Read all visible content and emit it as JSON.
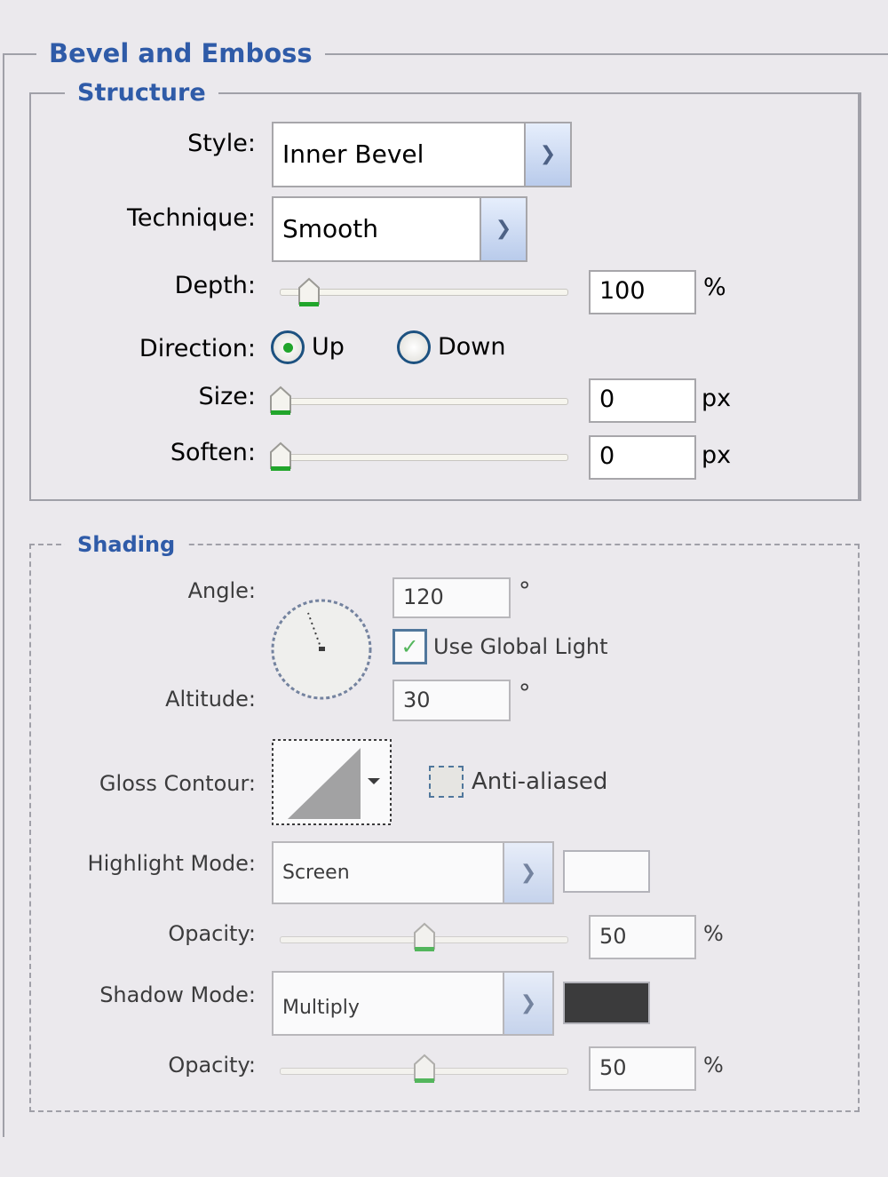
{
  "title": "Bevel and Emboss",
  "structure": {
    "title": "Structure",
    "style": {
      "label": "Style:",
      "value": "Inner Bevel"
    },
    "technique": {
      "label": "Technique:",
      "value": "Smooth"
    },
    "depth": {
      "label": "Depth:",
      "value": "100",
      "unit": "%"
    },
    "direction": {
      "label": "Direction:",
      "up": "Up",
      "down": "Down",
      "selected": "Up"
    },
    "size": {
      "label": "Size:",
      "value": "0",
      "unit": "px"
    },
    "soften": {
      "label": "Soften:",
      "value": "0",
      "unit": "px"
    }
  },
  "shading": {
    "title": "Shading",
    "angle": {
      "label": "Angle:",
      "value": "120",
      "unit": "°"
    },
    "global_light": {
      "label": "Use Global Light",
      "checked": true
    },
    "altitude": {
      "label": "Altitude:",
      "value": "30",
      "unit": "°"
    },
    "gloss_contour": {
      "label": "Gloss Contour:"
    },
    "anti_aliased": {
      "label": "Anti-aliased",
      "checked": false
    },
    "highlight_mode": {
      "label": "Highlight Mode:",
      "value": "Screen",
      "color": "#ffffff"
    },
    "highlight_opacity": {
      "label": "Opacity:",
      "value": "50",
      "unit": "%"
    },
    "shadow_mode": {
      "label": "Shadow Mode:",
      "value": "Multiply",
      "color": "#000000"
    },
    "shadow_opacity": {
      "label": "Opacity:",
      "value": "50",
      "unit": "%"
    }
  },
  "colors": {
    "accent": "#2f5ba8",
    "thumb_green": "#21a52b"
  }
}
